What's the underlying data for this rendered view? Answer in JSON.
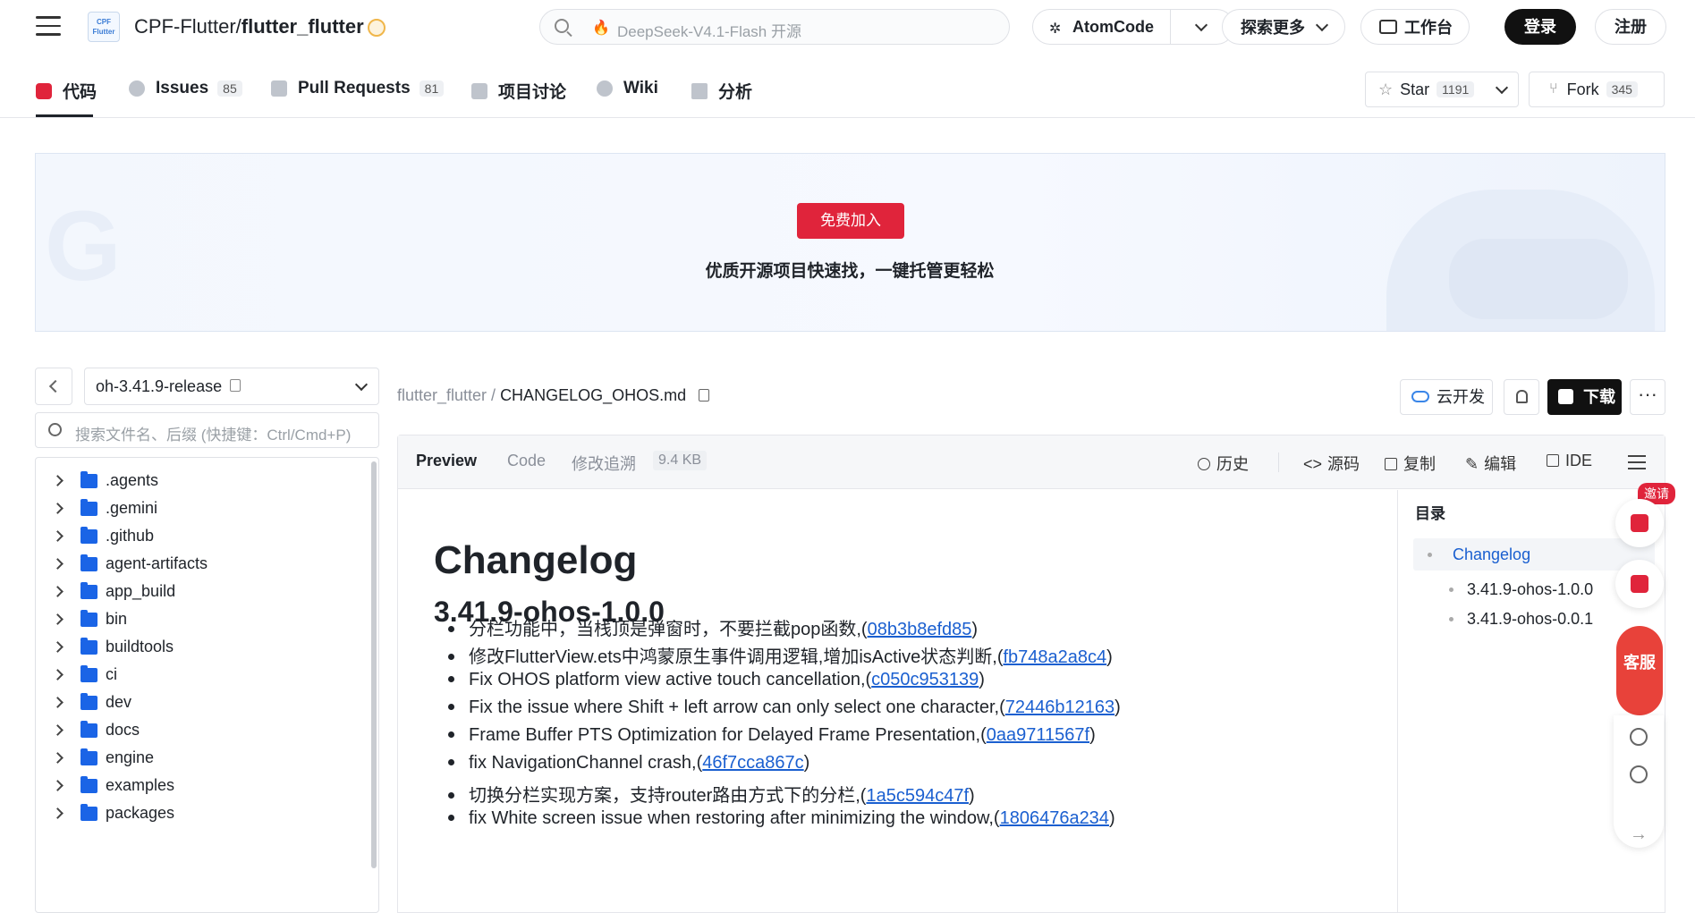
{
  "header": {
    "logo_text": "CPF Flutter",
    "owner": "CPF-Flutter/",
    "repo": "flutter_flutter",
    "search_placeholder": "DeepSeek-V4.1-Flash 开源",
    "atomcode": "AtomCode",
    "explore": "探索更多",
    "workbench": "工作台",
    "login": "登录",
    "register": "注册"
  },
  "tabs": [
    {
      "label": "代码",
      "count": ""
    },
    {
      "label": "Issues",
      "count": "85"
    },
    {
      "label": "Pull Requests",
      "count": "81"
    },
    {
      "label": "项目讨论",
      "count": ""
    },
    {
      "label": "Wiki",
      "count": ""
    },
    {
      "label": "分析",
      "count": ""
    }
  ],
  "repo_actions": {
    "star": "Star",
    "star_count": "1191",
    "fork": "Fork",
    "fork_count": "345"
  },
  "banner": {
    "button": "免费加入",
    "slogan": "优质开源项目快速找，一键托管更轻松"
  },
  "sidebar": {
    "branch": "oh-3.41.9-release",
    "search_placeholder": "搜索文件名、后缀 (快捷键：Ctrl/Cmd+P)",
    "folders": [
      ".agents",
      ".gemini",
      ".github",
      "agent-artifacts",
      "app_build",
      "bin",
      "buildtools",
      "ci",
      "dev",
      "docs",
      "engine",
      "examples",
      "packages"
    ]
  },
  "file": {
    "breadcrumb_repo": "flutter_flutter",
    "breadcrumb_sep": " / ",
    "name": "CHANGELOG_OHOS.md",
    "cloud_dev": "云开发",
    "download": "下载",
    "more": "···"
  },
  "viewer": {
    "tabs": [
      "Preview",
      "Code",
      "修改追溯"
    ],
    "size": "9.4 KB",
    "actions": [
      "历史",
      "源码",
      "复制",
      "编辑",
      "IDE"
    ]
  },
  "markdown": {
    "h1": "Changelog",
    "h2": "3.41.9-ohos-1.0.0",
    "items": [
      {
        "text": "分栏功能中，当栈顶是弹窗时，不要拦截pop函数,(",
        "hash": "08b3b8efd85",
        "tail": ")"
      },
      {
        "text": "修改FlutterView.ets中鸿蒙原生事件调用逻辑,增加isActive状态判断,(",
        "hash": "fb748a2a8c4",
        "tail": ")"
      },
      {
        "text": "Fix OHOS platform view active touch cancellation,(",
        "hash": "c050c953139",
        "tail": ")"
      },
      {
        "text": "Fix the issue where Shift + left arrow can only select one character,(",
        "hash": "72446b12163",
        "tail": ")"
      },
      {
        "text": "Frame Buffer PTS Optimization for Delayed Frame Presentation,(",
        "hash": "0aa9711567f",
        "tail": ")"
      },
      {
        "text": "fix NavigationChannel crash,(",
        "hash": "46f7cca867c",
        "tail": ")"
      },
      {
        "text": "切换分栏实现方案，支持router路由方式下的分栏,(",
        "hash": "1a5c594c47f",
        "tail": ")"
      },
      {
        "text": "fix White screen issue when restoring after minimizing the window,(",
        "hash": "1806476a234",
        "tail": ")"
      }
    ]
  },
  "toc": {
    "title": "目录",
    "items": [
      "Changelog",
      "3.41.9-ohos-1.0.0",
      "3.41.9-ohos-0.0.1"
    ]
  },
  "floating": {
    "invite": "邀请",
    "service": "客服"
  },
  "colors": {
    "accent": "#e0243b",
    "link": "#1a5fd0",
    "folder": "#1a64e6"
  }
}
